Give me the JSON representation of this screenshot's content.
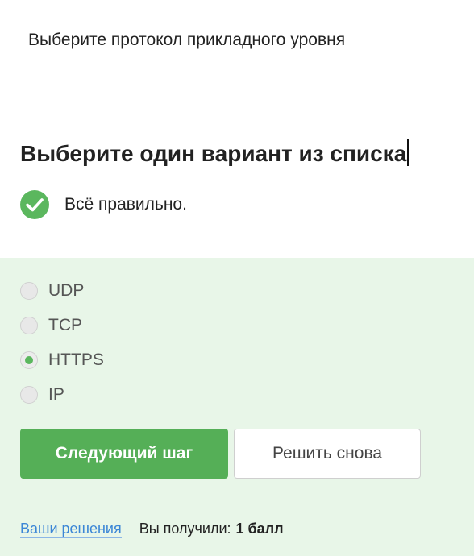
{
  "question": {
    "text": "Выберите протокол прикладного уровня"
  },
  "instruction": {
    "heading": "Выберите один вариант из списка"
  },
  "feedback": {
    "text": "Всё правильно.",
    "icon": "check-icon",
    "color": "#5bb75e"
  },
  "options": [
    {
      "label": "UDP",
      "selected": false
    },
    {
      "label": "TCP",
      "selected": false
    },
    {
      "label": "HTTPS",
      "selected": true
    },
    {
      "label": "IP",
      "selected": false
    }
  ],
  "buttons": {
    "next_label": "Следующий шаг",
    "retry_label": "Решить снова"
  },
  "footer": {
    "solutions_link": "Ваши решения",
    "score_prefix": "Вы получили:",
    "score_value": "1 балл"
  },
  "colors": {
    "accent_green": "#55af57",
    "panel_background": "#e8f6e8",
    "link_blue": "#3b86d6"
  }
}
